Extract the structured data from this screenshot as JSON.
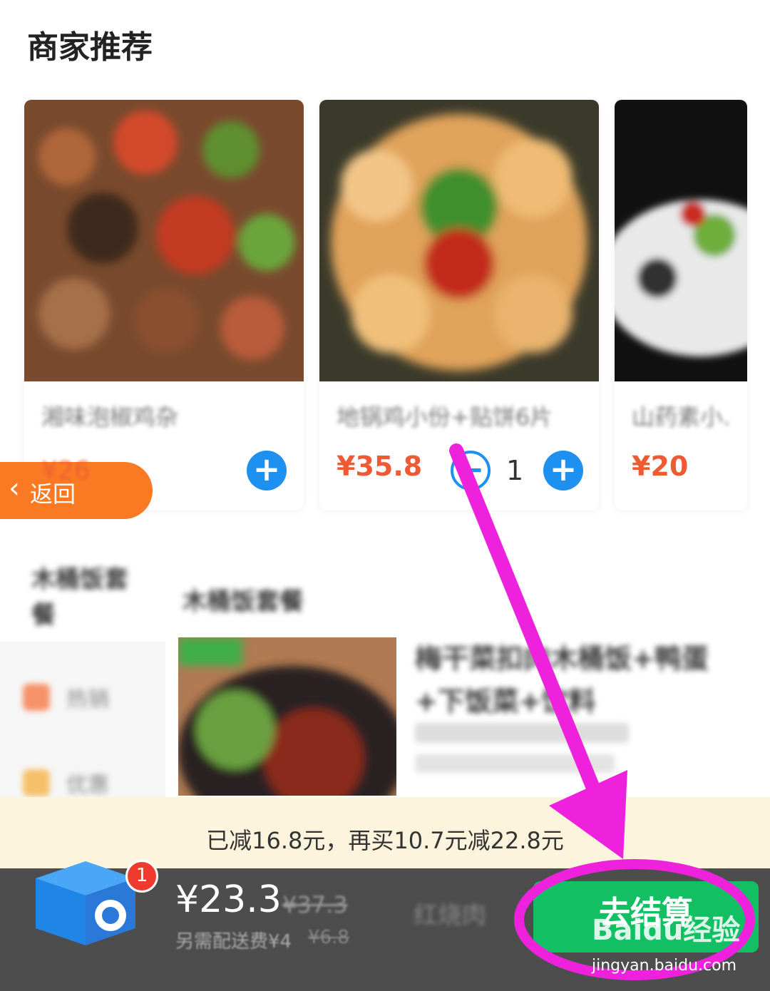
{
  "header": {
    "title": "商家推荐"
  },
  "recommendations": [
    {
      "name": "湘味泡椒鸡杂",
      "price": "¥26"
    },
    {
      "name": "地锅鸡小份+贴饼6片",
      "price": "¥35.8",
      "quantity": "1"
    },
    {
      "name": "山药素小…",
      "price": "¥20"
    }
  ],
  "nav": {
    "back_label": "返回"
  },
  "menu": {
    "category_title": "木桶饭套餐",
    "side_categories": [
      "木桶饭套餐",
      "热销",
      "优惠"
    ],
    "featured_item_name": "梅干菜扣肉木桶饭+鸭蛋+下饭菜+饮料"
  },
  "promo": {
    "text": "已减16.8元，再买10.7元减22.8元"
  },
  "cart": {
    "count": "1",
    "total": "¥23.3",
    "original_total": "¥37.3",
    "delivery_fee": "另需配送费¥4",
    "delivery_fee_original": "¥6.8",
    "item_hint": "红烧肉",
    "checkout_label": "去结算"
  },
  "watermark": {
    "brand": "Baidu经验",
    "url": "jingyan.baidu.com"
  },
  "colors": {
    "price": "#ef5a33",
    "accent_blue": "#1e90f0",
    "checkout_green": "#12c063",
    "back_orange": "#fa7a24",
    "annotation": "#ee22dd"
  }
}
